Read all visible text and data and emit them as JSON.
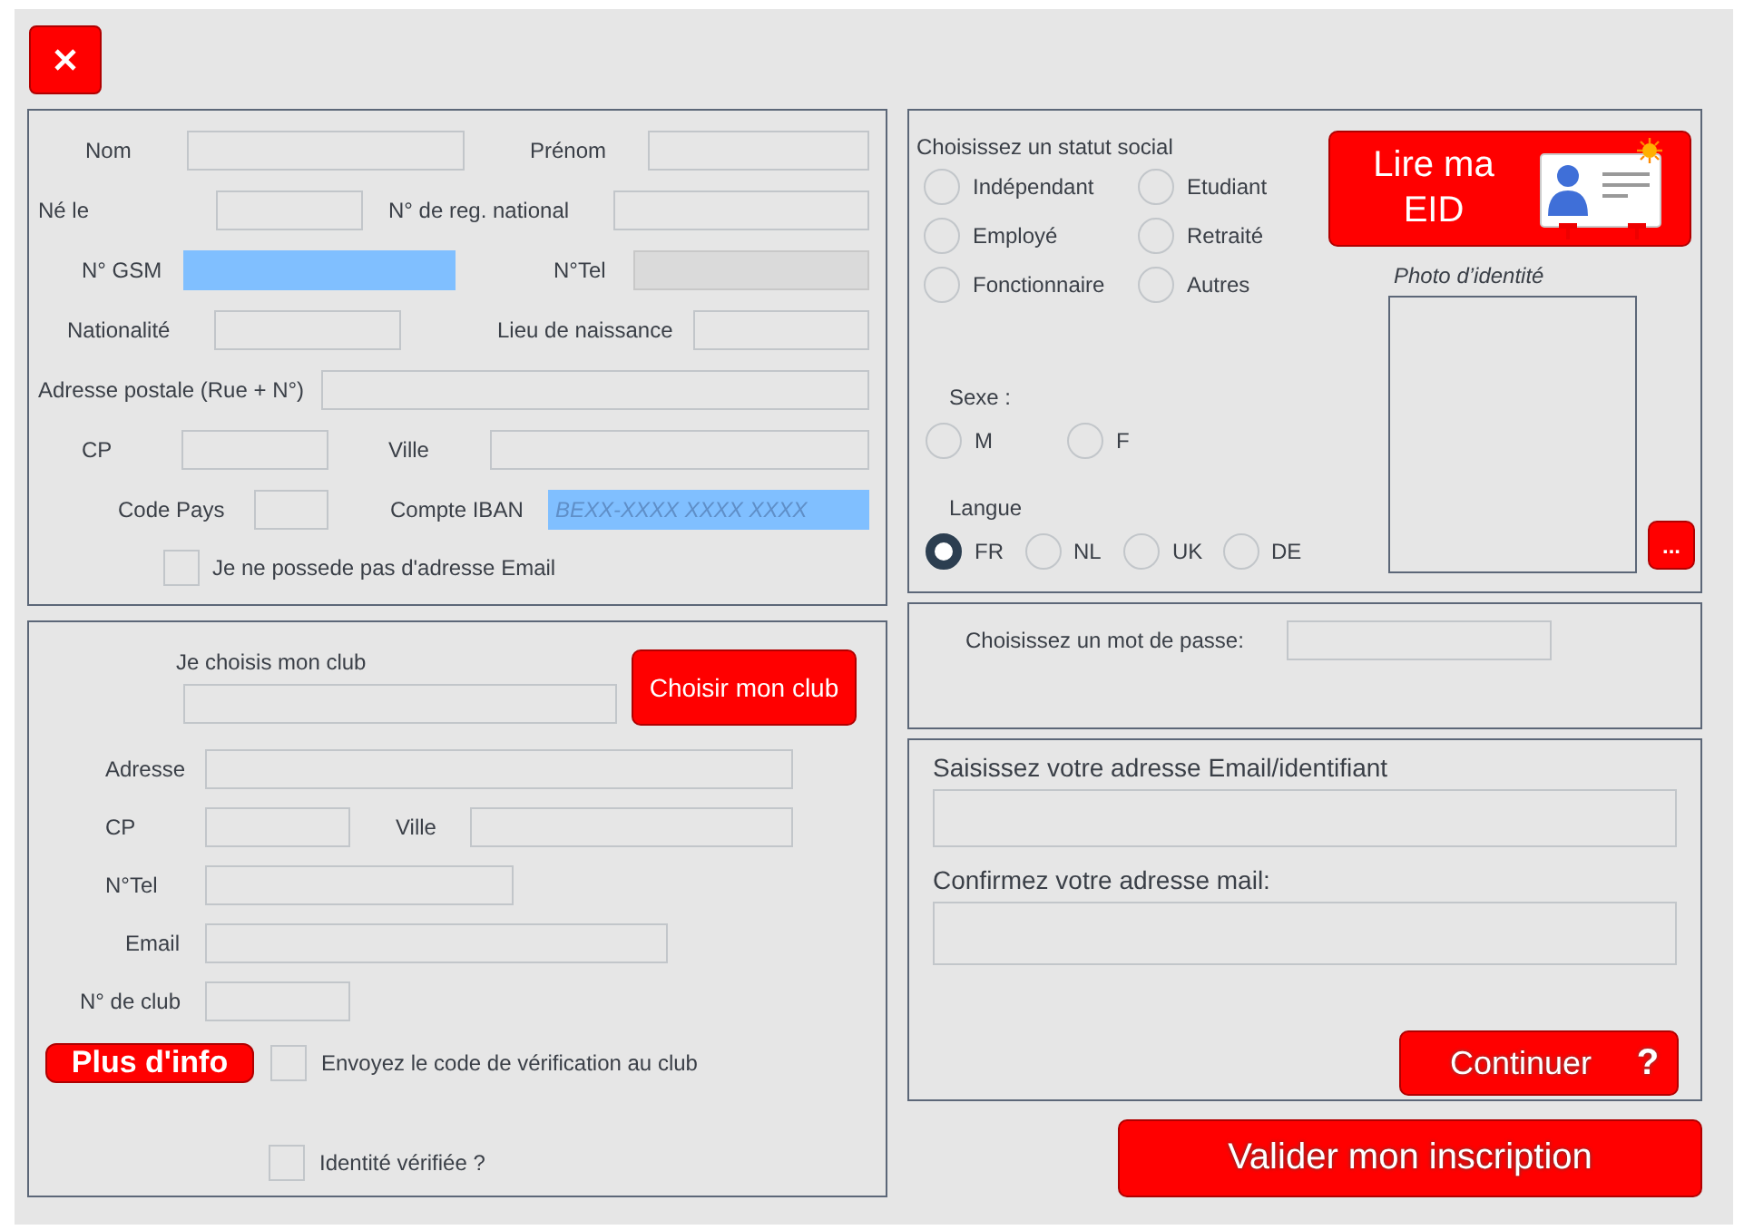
{
  "identity": {
    "rows": [
      [
        {
          "label": "Nom",
          "highlighted": false,
          "disabled": false
        },
        {
          "label": "Prénom",
          "highlighted": false,
          "disabled": false
        }
      ],
      [
        {
          "label": "Né le",
          "highlighted": false,
          "disabled": false
        },
        {
          "label": "N° de reg. national",
          "highlighted": false,
          "disabled": false
        }
      ],
      [
        {
          "label": "N° GSM",
          "highlighted": true,
          "disabled": false
        },
        {
          "label": "N°Tel",
          "highlighted": false,
          "disabled": true
        }
      ],
      [
        {
          "label": "Nationalité",
          "highlighted": false,
          "disabled": false
        },
        {
          "label": "Lieu de naissance",
          "highlighted": false,
          "disabled": false
        }
      ],
      [
        {
          "label": "Adresse postale (Rue + N°)",
          "highlighted": false,
          "disabled": false
        }
      ],
      [
        {
          "label": "CP",
          "highlighted": false,
          "disabled": false
        },
        {
          "label": "Ville",
          "highlighted": false,
          "disabled": false
        }
      ],
      [
        {
          "label": "Code Pays",
          "highlighted": false,
          "disabled": false
        },
        {
          "label": "Compte IBAN",
          "highlighted": true,
          "disabled": false,
          "placeholder": "BEXX-XXXX XXXX XXXX"
        }
      ]
    ],
    "no_email": {
      "label": "Je ne possede pas d'adresse Email",
      "checked": false
    }
  },
  "status": {
    "title": "Choisissez un statut social",
    "options": [
      {
        "label": "Indépendant",
        "selected": false
      },
      {
        "label": "Etudiant",
        "selected": false
      },
      {
        "label": "Employé",
        "selected": false
      },
      {
        "label": "Retraité",
        "selected": false
      },
      {
        "label": "Fonctionnaire",
        "selected": false
      },
      {
        "label": "Autres",
        "selected": false
      }
    ]
  },
  "eid_button": "Lire ma EID",
  "photo": {
    "label": "Photo d’identité",
    "browse_button": "..."
  },
  "sexe": {
    "label": "Sexe :",
    "options": [
      {
        "label": "M",
        "selected": false
      },
      {
        "label": "F",
        "selected": false
      }
    ]
  },
  "langue": {
    "label": "Langue",
    "options": [
      {
        "label": "FR",
        "selected": true
      },
      {
        "label": "NL",
        "selected": false
      },
      {
        "label": "UK",
        "selected": false
      },
      {
        "label": "DE",
        "selected": false
      }
    ]
  },
  "club": {
    "title": "Je choisis mon club",
    "choose_button": "Choisir mon club",
    "rows": [
      [
        {
          "label": "Adresse",
          "highlighted": false,
          "disabled": false
        }
      ],
      [
        {
          "label": "CP",
          "highlighted": false,
          "disabled": false
        },
        {
          "label": "Ville",
          "highlighted": false,
          "disabled": false
        }
      ],
      [
        {
          "label": "N°Tel",
          "highlighted": false,
          "disabled": false
        }
      ],
      [
        {
          "label": "Email",
          "highlighted": false,
          "disabled": false
        }
      ],
      [
        {
          "label": "N° de club",
          "highlighted": false,
          "disabled": false
        }
      ]
    ],
    "more_info_button": "Plus d'info",
    "send_code": {
      "label": "Envoyez le code de vérification au club",
      "checked": false
    },
    "identity_verified": {
      "label": "Identité vérifiée ?",
      "checked": false
    }
  },
  "password": {
    "label": "Choisissez un mot de passe:"
  },
  "login": {
    "email_label": "Saisissez votre adresse Email/identifiant",
    "confirm_label": "Confirmez votre adresse mail:",
    "continue_button": "Continuer",
    "help_mark": "?"
  },
  "submit_button": "Valider mon inscription"
}
